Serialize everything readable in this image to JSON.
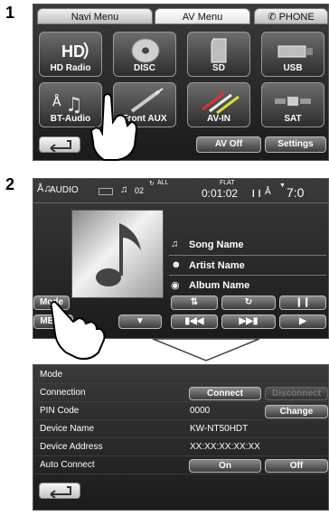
{
  "steps": [
    "1",
    "2"
  ],
  "panel1": {
    "tabs": [
      "Navi Menu",
      "AV Menu",
      "PHONE"
    ],
    "tiles": [
      {
        "label": "HD Radio",
        "icon": "hd-radio-icon"
      },
      {
        "label": "DISC",
        "icon": "disc-icon"
      },
      {
        "label": "SD",
        "icon": "sd-card-icon"
      },
      {
        "label": "USB",
        "icon": "usb-icon"
      },
      {
        "label": "BT-Audio",
        "icon": "bluetooth-music-icon"
      },
      {
        "label": "Front AUX",
        "icon": "aux-cable-icon"
      },
      {
        "label": "AV-IN",
        "icon": "av-cable-icon"
      },
      {
        "label": "SAT",
        "icon": "satellite-icon"
      }
    ],
    "back_icon": "back-arrow-icon",
    "av_off": "AV Off",
    "settings": "Settings"
  },
  "panel2": {
    "source": "AUDIO",
    "track_no": "02",
    "repeat": "ALL",
    "flat": "FLAT",
    "time": "0:01:02",
    "clock": "7:0",
    "song": "Song Name",
    "artist": "Artist Name",
    "album": "Album Name",
    "mode": "Mode",
    "menu": "MENU"
  },
  "panel3": {
    "title": "Mode",
    "rows": [
      {
        "key": "Connection"
      },
      {
        "key": "PIN Code",
        "value": "0000"
      },
      {
        "key": "Device Name",
        "value": "KW-NT50HDT"
      },
      {
        "key": "Device Address",
        "value": "XX:XX:XX:XX:XX"
      },
      {
        "key": "Auto Connect"
      }
    ],
    "connect": "Connect",
    "disconnect": "Disconnect",
    "change": "Change",
    "on": "On",
    "off": "Off"
  },
  "colors": {
    "panel_bg": "#262626",
    "button_light": "#e6e6e6"
  }
}
